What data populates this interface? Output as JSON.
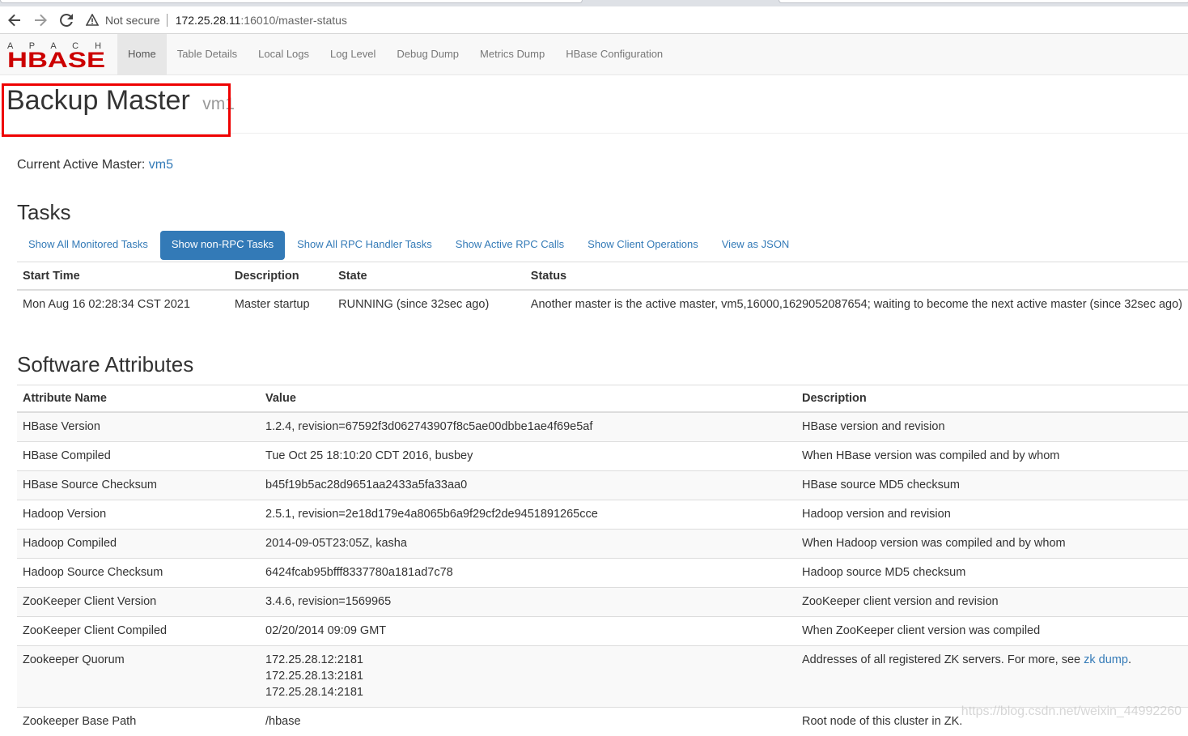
{
  "browser": {
    "security_label": "Not secure",
    "url_host": "172.25.28.11",
    "url_rest": ":16010/master-status"
  },
  "navbar": {
    "logo_top": "A P A C H E",
    "logo_main": "HBASE",
    "items": [
      {
        "label": "Home",
        "active": true
      },
      {
        "label": "Table Details"
      },
      {
        "label": "Local Logs"
      },
      {
        "label": "Log Level"
      },
      {
        "label": "Debug Dump"
      },
      {
        "label": "Metrics Dump"
      },
      {
        "label": "HBase Configuration"
      }
    ]
  },
  "header": {
    "title": "Backup Master",
    "subtitle": "vm1"
  },
  "active_master": {
    "label": "Current Active Master:",
    "value": "vm5"
  },
  "tasks": {
    "title": "Tasks",
    "tabs": [
      {
        "label": "Show All Monitored Tasks"
      },
      {
        "label": "Show non-RPC Tasks",
        "active": true
      },
      {
        "label": "Show All RPC Handler Tasks"
      },
      {
        "label": "Show Active RPC Calls"
      },
      {
        "label": "Show Client Operations"
      },
      {
        "label": "View as JSON"
      }
    ],
    "columns": [
      "Start Time",
      "Description",
      "State",
      "Status"
    ],
    "rows": [
      [
        "Mon Aug 16 02:28:34 CST 2021",
        "Master startup",
        "RUNNING (since 32sec ago)",
        "Another master is the active master, vm5,16000,1629052087654; waiting to become the next active master (since 32sec ago)"
      ]
    ]
  },
  "software": {
    "title": "Software Attributes",
    "columns": [
      "Attribute Name",
      "Value",
      "Description"
    ],
    "rows": [
      [
        "HBase Version",
        "1.2.4, revision=67592f3d062743907f8c5ae00dbbe1ae4f69e5af",
        "HBase version and revision"
      ],
      [
        "HBase Compiled",
        "Tue Oct 25 18:10:20 CDT 2016, busbey",
        "When HBase version was compiled and by whom"
      ],
      [
        "HBase Source Checksum",
        "b45f19b5ac28d9651aa2433a5fa33aa0",
        "HBase source MD5 checksum"
      ],
      [
        "Hadoop Version",
        "2.5.1, revision=2e18d179e4a8065b6a9f29cf2de9451891265cce",
        "Hadoop version and revision"
      ],
      [
        "Hadoop Compiled",
        "2014-09-05T23:05Z, kasha",
        "When Hadoop version was compiled and by whom"
      ],
      [
        "Hadoop Source Checksum",
        "6424fcab95bfff8337780a181ad7c78",
        "Hadoop source MD5 checksum"
      ],
      [
        "ZooKeeper Client Version",
        "3.4.6, revision=1569965",
        "ZooKeeper client version and revision"
      ],
      [
        "ZooKeeper Client Compiled",
        "02/20/2014 09:09 GMT",
        "When ZooKeeper client version was compiled"
      ]
    ],
    "quorum": {
      "name": "Zookeeper Quorum",
      "values": [
        "172.25.28.12:2181",
        "172.25.28.13:2181",
        "172.25.28.14:2181"
      ],
      "desc_prefix": "Addresses of all registered ZK servers. For more, see",
      "desc_link": "zk dump",
      "desc_suffix": "."
    },
    "base_path": {
      "name": "Zookeeper Base Path",
      "value": "/hbase",
      "desc": "Root node of this cluster in ZK."
    }
  },
  "watermark": "https://blog.csdn.net/weixin_44992260"
}
